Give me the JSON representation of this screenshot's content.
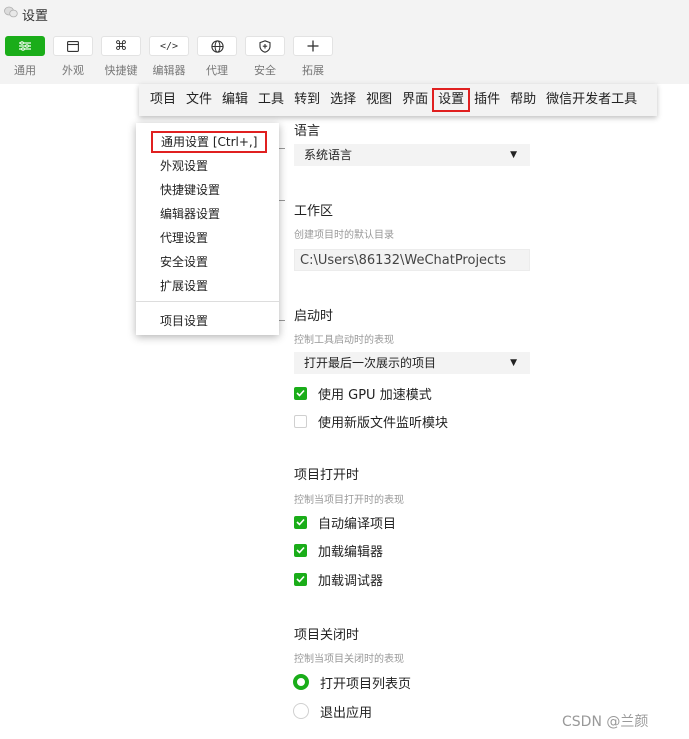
{
  "window": {
    "title": "设置"
  },
  "toolbar": {
    "items": [
      {
        "label": "通用",
        "icon": "sliders-icon",
        "active": true
      },
      {
        "label": "外观",
        "icon": "window-icon"
      },
      {
        "label": "快捷键",
        "icon": "command-icon"
      },
      {
        "label": "编辑器",
        "icon": "code-icon"
      },
      {
        "label": "代理",
        "icon": "globe-icon"
      },
      {
        "label": "安全",
        "icon": "shield-icon"
      },
      {
        "label": "拓展",
        "icon": "plus-icon"
      }
    ]
  },
  "menubar": {
    "items": [
      "项目",
      "文件",
      "编辑",
      "工具",
      "转到",
      "选择",
      "视图",
      "界面",
      "设置",
      "插件",
      "帮助",
      "微信开发者工具"
    ],
    "selected": "设置"
  },
  "dropdown": {
    "items": [
      "通用设置  [Ctrl+,]",
      "外观设置",
      "快捷键设置",
      "编辑器设置",
      "代理设置",
      "安全设置",
      "扩展设置"
    ],
    "footer_item": "项目设置"
  },
  "settings": {
    "language": {
      "title": "语言",
      "value": "系统语言"
    },
    "workspace": {
      "title": "工作区",
      "desc": "创建项目时的默认目录",
      "value": "C:\\Users\\86132\\WeChatProjects"
    },
    "startup": {
      "title": "启动时",
      "desc": "控制工具启动时的表现",
      "value": "打开最后一次展示的项目",
      "gpu_label": "使用 GPU 加速模式",
      "gpu_checked": true,
      "watcher_label": "使用新版文件监听模块",
      "watcher_checked": false
    },
    "project_open": {
      "title": "项目打开时",
      "desc": "控制当项目打开时的表现",
      "compile_label": "自动编译项目",
      "editor_label": "加载编辑器",
      "debugger_label": "加载调试器"
    },
    "project_close": {
      "title": "项目关闭时",
      "desc": "控制当项目关闭时的表现",
      "list_label": "打开项目列表页",
      "exit_label": "退出应用",
      "selected": "打开项目列表页"
    }
  },
  "colors": {
    "accent": "#1aad19",
    "highlight": "#e02020"
  },
  "watermark": "CSDN @兰颜"
}
